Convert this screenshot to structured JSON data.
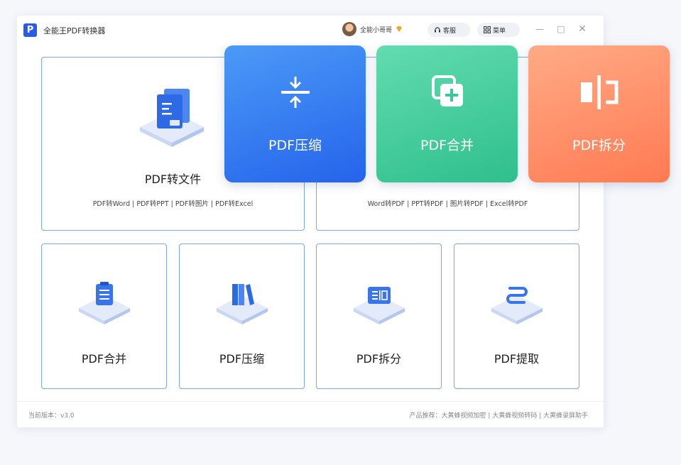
{
  "app": {
    "logo": "P",
    "title": "全能王PDF转换器"
  },
  "header": {
    "username": "全能小哥哥",
    "service_label": "客服",
    "menu_label": "菜单",
    "minimize": "—",
    "maximize": "□",
    "close": "✕"
  },
  "cards": {
    "pdf_to_file": {
      "title": "PDF转文件",
      "sub": "PDF转Word | PDF转PPT | PDF转图片 | PDF转Excel"
    },
    "file_to_pdf": {
      "sub": "Word转PDF | PPT转PDF | 图片转PDF | Excel转PDF"
    },
    "small": [
      {
        "title": "PDF合并",
        "icon": "clipboard-icon"
      },
      {
        "title": "PDF压缩",
        "icon": "books-icon"
      },
      {
        "title": "PDF拆分",
        "icon": "split-doc-icon"
      },
      {
        "title": "PDF提取",
        "icon": "extract-icon"
      }
    ]
  },
  "tiles": [
    {
      "label": "PDF压缩",
      "icon": "compress-icon",
      "color": "#2f6ff0"
    },
    {
      "label": "PDF合并",
      "icon": "merge-icon",
      "color": "#3cc797"
    },
    {
      "label": "PDF拆分",
      "icon": "split-icon",
      "color": "#ff8a62"
    }
  ],
  "footer": {
    "version": "当前版本：v3.0",
    "products": "产品推荐：大黄蜂视频加密 | 大黄蜂视频转码 | 大黄蜂录屏助手"
  }
}
